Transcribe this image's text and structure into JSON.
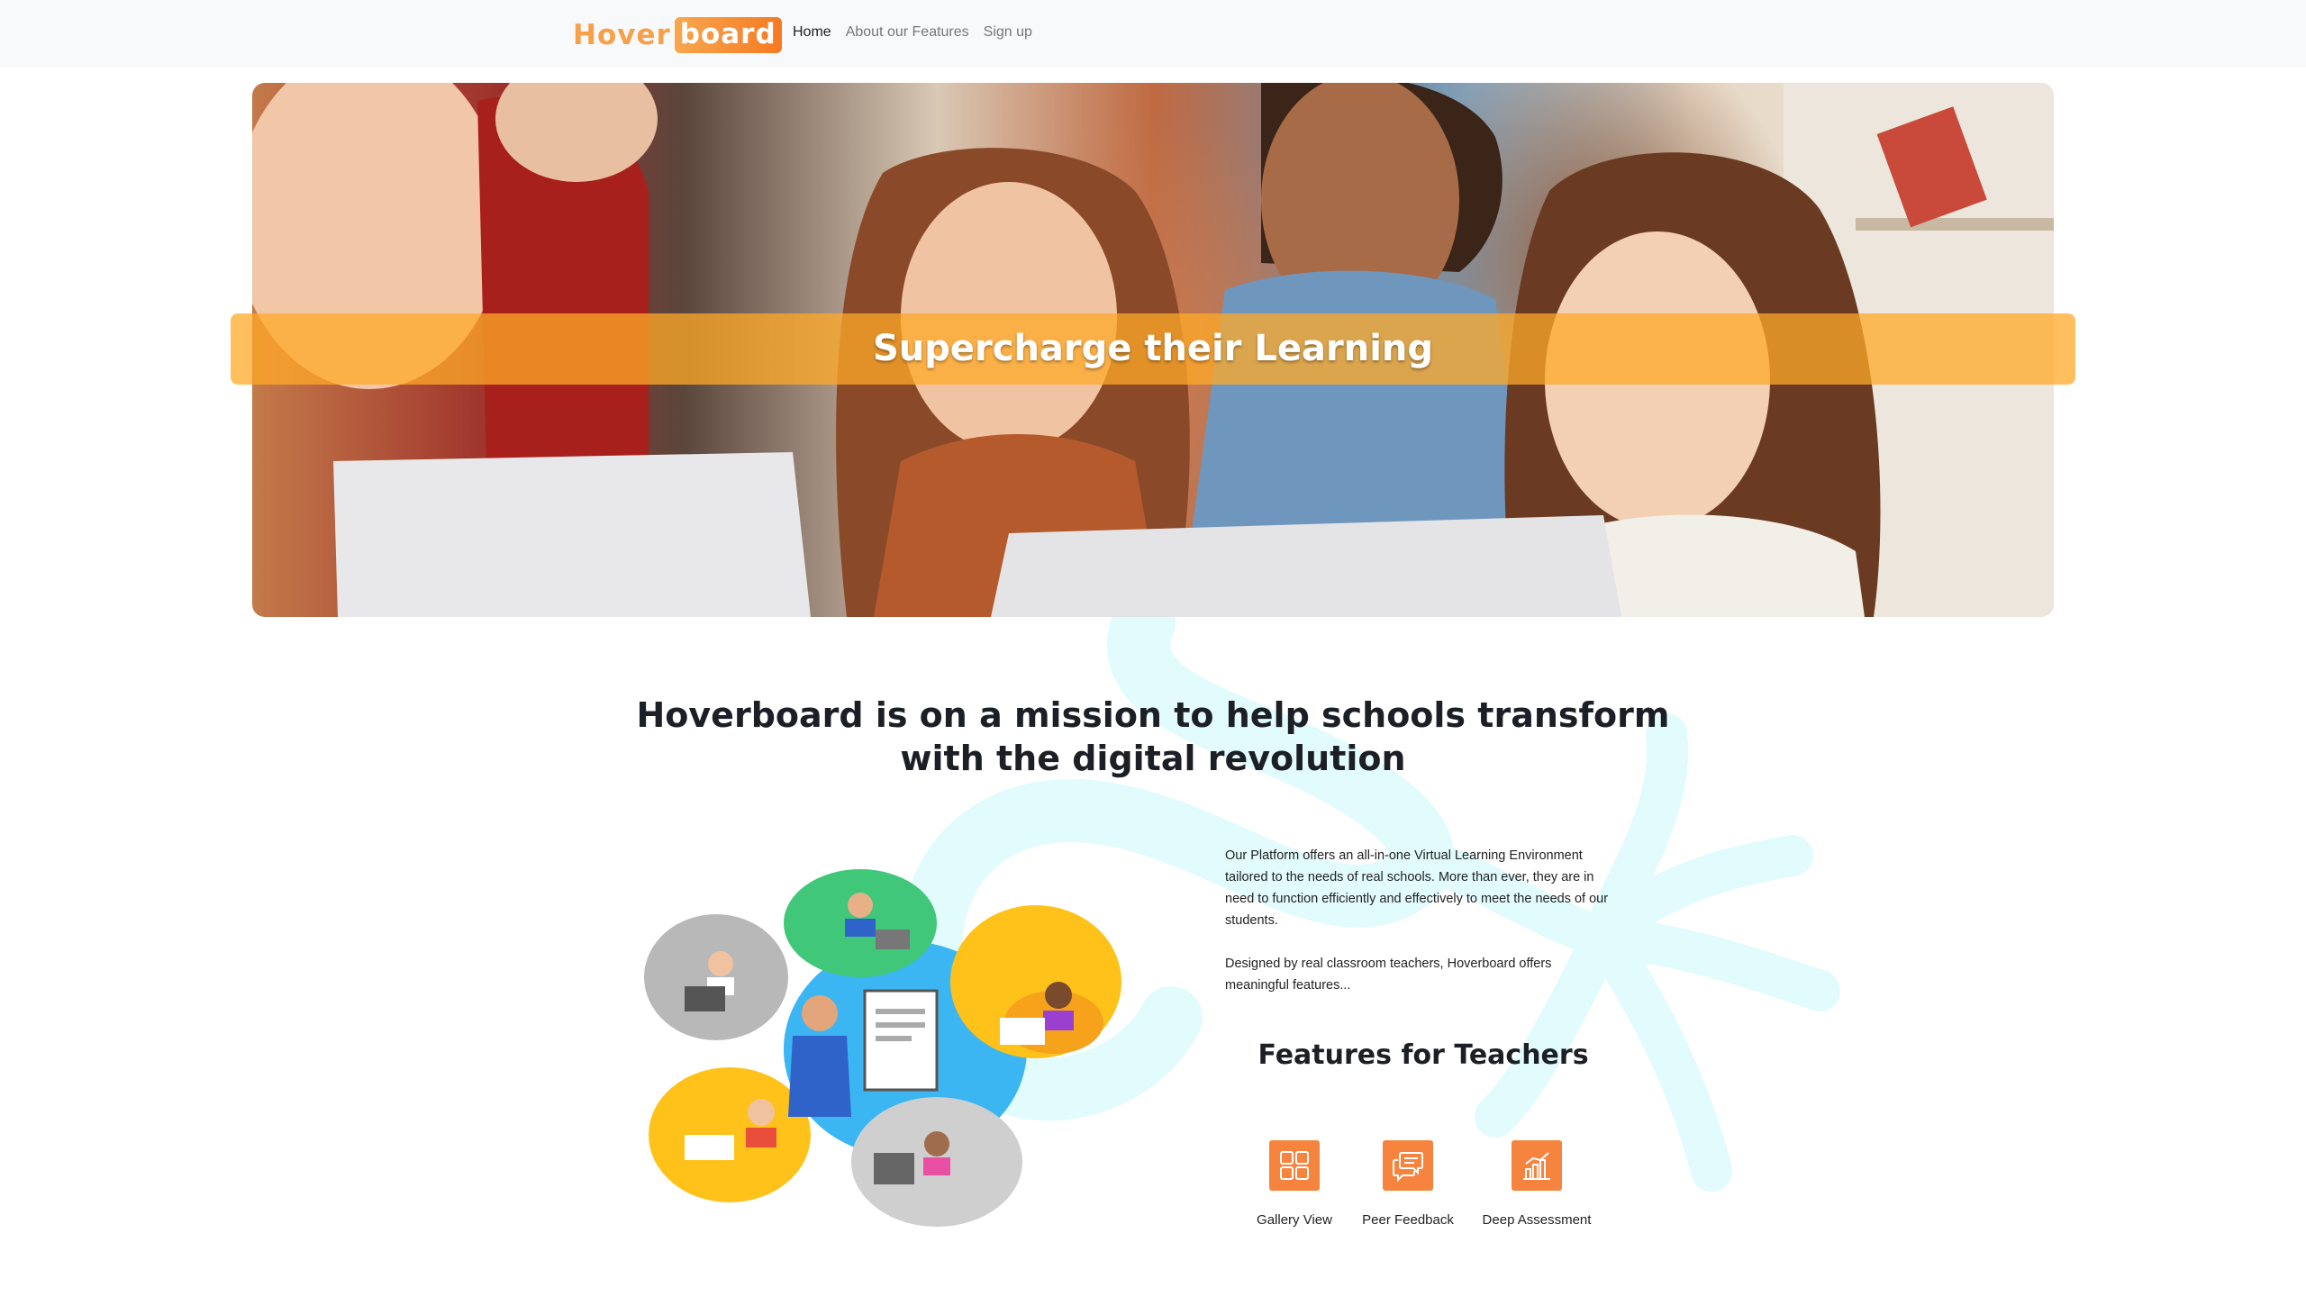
{
  "navbar": {
    "brand_part1": "Hover",
    "brand_part2": "board",
    "links": [
      "Home",
      "About our Features",
      "Sign up"
    ]
  },
  "hero": {
    "title": "Supercharge their Learning"
  },
  "mission": {
    "heading": "Hoverboard is on a mission to help schools transform with the digital revolution"
  },
  "description": {
    "paragraph1": "Our Platform offers an all-in-one Virtual Learning Environment tailored to the needs of real schools. More than ever, they are in need to function efficiently and effectively to meet the needs of our students.",
    "paragraph2": "Designed by real classroom teachers, Hoverboard offers meaningful features..."
  },
  "features": {
    "title": "Features for Teachers",
    "items": [
      {
        "label": "Gallery View",
        "icon": "grid-icon"
      },
      {
        "label": "Peer Feedback",
        "icon": "chat-bubbles-icon"
      },
      {
        "label": "Deep Assessment",
        "icon": "bar-chart-icon"
      }
    ]
  },
  "colors": {
    "accent_orange": "#f6843f",
    "hero_band": "#ffaa28",
    "decor_cyan": "#e2fbfd",
    "navbar_bg": "#f8f9fa"
  }
}
